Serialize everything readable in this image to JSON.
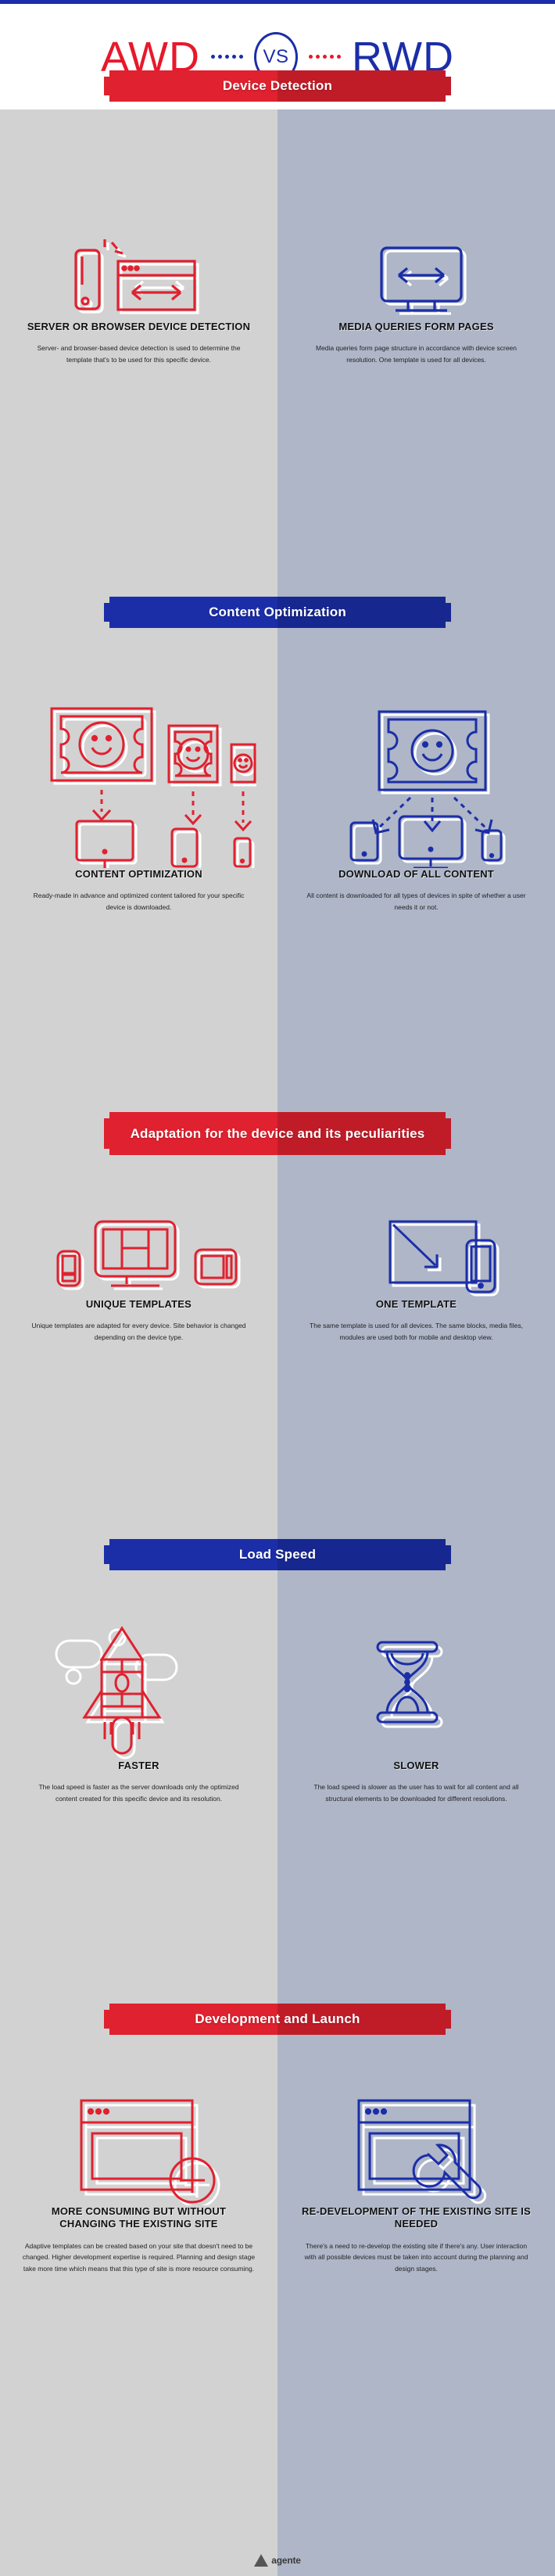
{
  "theme": {
    "red": "#e0212f",
    "blue": "#1b2ea8",
    "left_bg": "#d2d2d2",
    "right_bg": "#aeb6c8"
  },
  "hero": {
    "left_word": "AWD",
    "vs_label": "VS",
    "right_word": "RWD"
  },
  "sections": [
    {
      "banner": "Device Detection",
      "banner_color": "red",
      "left": {
        "icon": "phone-and-browser-window-icon",
        "title": "SERVER OR BROWSER DEVICE DETECTION",
        "body": "Server- and browser-based device detection is used to determine the template that's to be used for this specific device."
      },
      "right": {
        "icon": "monitor-resize-arrows-icon",
        "title": "MEDIA QUERIES FORM PAGES",
        "body": "Media queries form page structure in accordance with device screen resolution. One template is used for all devices."
      }
    },
    {
      "banner": "Content Optimization",
      "banner_color": "blue",
      "left": {
        "icon": "three-sized-images-to-devices-icon",
        "title": "CONTENT OPTIMIZATION",
        "body": "Ready-made in advance and optimized content tailored for your specific device is downloaded."
      },
      "right": {
        "icon": "one-image-to-all-devices-icon",
        "title": "DOWNLOAD OF ALL CONTENT",
        "body": "All content is downloaded for all types of devices in spite of whether a user needs it or not."
      }
    },
    {
      "banner": "Adaptation for the device and its peculiarities",
      "banner_color": "red",
      "left": {
        "icon": "multiple-device-templates-icon",
        "title": "UNIQUE TEMPLATES",
        "body": "Unique templates are adapted for every device. Site behavior is changed depending on the device type."
      },
      "right": {
        "icon": "scaling-screen-to-phone-icon",
        "title": "ONE TEMPLATE",
        "body": "The same template is used for all devices. The same blocks, media files, modules are used both for mobile and desktop view."
      }
    },
    {
      "banner": "Load Speed",
      "banner_color": "blue",
      "left": {
        "icon": "rocket-icon",
        "title": "FASTER",
        "body": "The load speed is faster as the server downloads only the optimized content created for this specific device and its resolution."
      },
      "right": {
        "icon": "hourglass-icon",
        "title": "SLOWER",
        "body": "The load speed is slower as the user has to wait for all content and all structural elements to be downloaded for different resolutions."
      }
    },
    {
      "banner": "Development and Launch",
      "banner_color": "red",
      "left": {
        "icon": "browser-window-plus-icon",
        "title": "MORE CONSUMING BUT WITHOUT CHANGING THE EXISTING SITE",
        "body": "Adaptive templates can be created based on your site that doesn't need to be changed. Higher development expertise is required. Planning and design stage take more time which means that this type of site is more resource consuming."
      },
      "right": {
        "icon": "browser-window-wrench-icon",
        "title": "RE-DEVELOPMENT OF THE EXISTING SITE IS NEEDED",
        "body": "There's a need to re-develop the existing site if there's any. User interaction with all possible devices must be taken into account during the planning and design stages."
      }
    }
  ],
  "footer": {
    "logo_text": "agente"
  }
}
